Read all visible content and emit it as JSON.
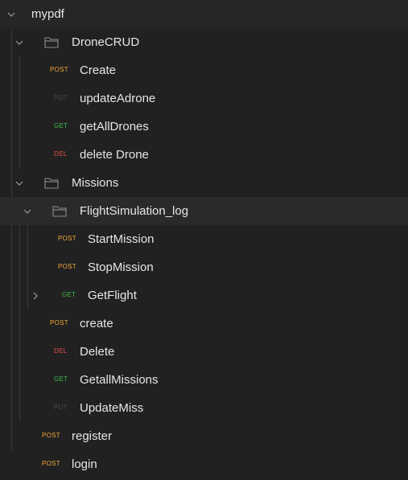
{
  "colors": {
    "background": "#212121",
    "text": "#e6e6e6",
    "post": "#f2a83b",
    "get": "#3fb950",
    "del": "#e5534b",
    "put": "#4a4a4a"
  },
  "workspace": {
    "name": "mypdf",
    "folders": [
      {
        "name": "DroneCRUD",
        "requests": [
          {
            "method": "POST",
            "name": "Create"
          },
          {
            "method": "PUT",
            "name": "updateAdrone"
          },
          {
            "method": "GET",
            "name": "getAllDrones"
          },
          {
            "method": "DEL",
            "name": "delete Drone"
          }
        ]
      },
      {
        "name": "Missions",
        "subfolder": {
          "name": "FlightSimulation_log",
          "requests": [
            {
              "method": "POST",
              "name": "StartMission"
            },
            {
              "method": "POST",
              "name": "StopMission"
            },
            {
              "method": "GET",
              "name": "GetFlight"
            }
          ]
        },
        "requests": [
          {
            "method": "POST",
            "name": "create"
          },
          {
            "method": "DEL",
            "name": "Delete"
          },
          {
            "method": "GET",
            "name": "GetallMissions"
          },
          {
            "method": "PUT",
            "name": "UpdateMiss"
          }
        ]
      }
    ],
    "requests": [
      {
        "method": "POST",
        "name": "register"
      },
      {
        "method": "POST",
        "name": "login"
      }
    ]
  }
}
